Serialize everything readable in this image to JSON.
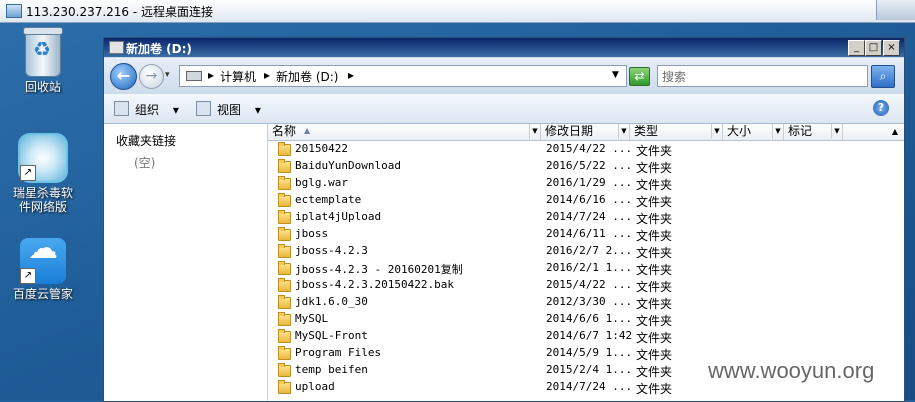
{
  "rdp": {
    "title": "113.230.237.216 - 远程桌面连接"
  },
  "desktop": {
    "icons": [
      {
        "label": "回收站"
      },
      {
        "label_line1": "瑞星杀毒软",
        "label_line2": "件网络版"
      },
      {
        "label": "百度云管家"
      }
    ]
  },
  "window": {
    "title": "新加卷 (D:)",
    "controls": {
      "minimize": "_",
      "maximize": "□",
      "close": "×"
    }
  },
  "address": {
    "crumbs": [
      "计算机",
      "新加卷 (D:)"
    ],
    "sep": "▸",
    "search_placeholder": "搜索"
  },
  "toolbar": {
    "organize": "组织",
    "views": "视图",
    "dropdown": "▾",
    "help": "?"
  },
  "nav_pane": {
    "favorites": "收藏夹链接",
    "empty": "(空)"
  },
  "columns": {
    "name": "名称",
    "date": "修改日期",
    "type": "类型",
    "size": "大小",
    "tags": "标记"
  },
  "files": [
    {
      "name": "20150422",
      "date": "2015/4/22 ...",
      "type": "文件夹"
    },
    {
      "name": "BaiduYunDownload",
      "date": "2016/5/22 ...",
      "type": "文件夹"
    },
    {
      "name": "bglg.war",
      "date": "2016/1/29 ...",
      "type": "文件夹"
    },
    {
      "name": "ectemplate",
      "date": "2014/6/16 ...",
      "type": "文件夹"
    },
    {
      "name": "iplat4jUpload",
      "date": "2014/7/24 ...",
      "type": "文件夹"
    },
    {
      "name": "jboss",
      "date": "2014/6/11 ...",
      "type": "文件夹"
    },
    {
      "name": "jboss-4.2.3",
      "date": "2016/2/7 2...",
      "type": "文件夹"
    },
    {
      "name": "jboss-4.2.3 - 20160201复制",
      "date": "2016/2/1 1...",
      "type": "文件夹"
    },
    {
      "name": "jboss-4.2.3.20150422.bak",
      "date": "2015/4/22 ...",
      "type": "文件夹"
    },
    {
      "name": "jdk1.6.0_30",
      "date": "2012/3/30 ...",
      "type": "文件夹"
    },
    {
      "name": "MySQL",
      "date": "2014/6/6 1...",
      "type": "文件夹"
    },
    {
      "name": "MySQL-Front",
      "date": "2014/6/7 1:42",
      "type": "文件夹"
    },
    {
      "name": "Program Files",
      "date": "2014/5/9 1...",
      "type": "文件夹"
    },
    {
      "name": "temp beifen",
      "date": "2015/2/4 1...",
      "type": "文件夹"
    },
    {
      "name": "upload",
      "date": "2014/7/24 ...",
      "type": "文件夹"
    }
  ],
  "watermark": "www.wooyun.org"
}
